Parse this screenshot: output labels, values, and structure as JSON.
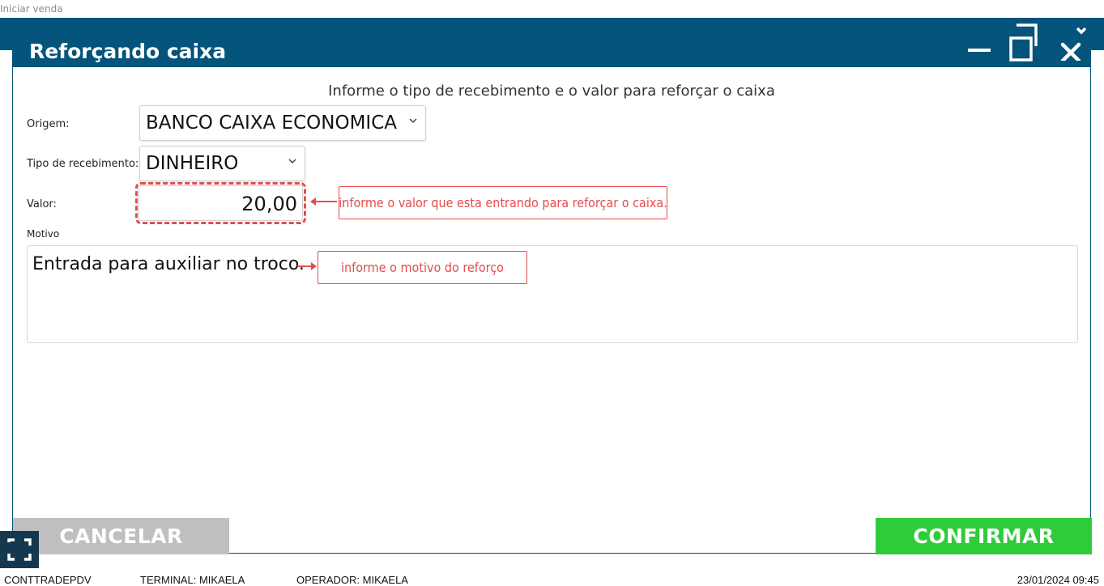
{
  "app": {
    "title": "Iniciar venda"
  },
  "dialog": {
    "title": "Reforçando caixa",
    "instruction": "Informe o tipo de recebimento e o valor para reforçar o caixa",
    "fields": {
      "origem_label": "Origem:",
      "origem_value": "BANCO CAIXA ECONOMICA",
      "tipo_label": "Tipo de recebimento:",
      "tipo_value": "DINHEIRO",
      "valor_label": "Valor:",
      "valor_value": "20,00",
      "motivo_label": "Motivo",
      "motivo_value": "Entrada para auxiliar no troco."
    },
    "annotations": {
      "valor_note": "informe o valor que esta entrando para reforçar o caixa.",
      "motivo_note": "informe o  motivo do reforço"
    },
    "buttons": {
      "cancel": "CANCELAR",
      "confirm": "CONFIRMAR"
    }
  },
  "status_bar": {
    "system": "CONTTRADEPDV",
    "terminal": "TERMINAL: MIKAELA",
    "operator": "OPERADOR: MIKAELA",
    "datetime": "23/01/2024 09:45"
  },
  "colors": {
    "header": "#04547c",
    "confirm": "#2fcc3a",
    "cancel": "#bfbfbf",
    "annotation": "#e34d4d"
  },
  "icons": [
    "minimize-icon",
    "restore-icon",
    "close-icon",
    "chevron-down-icon",
    "fullscreen-icon"
  ]
}
